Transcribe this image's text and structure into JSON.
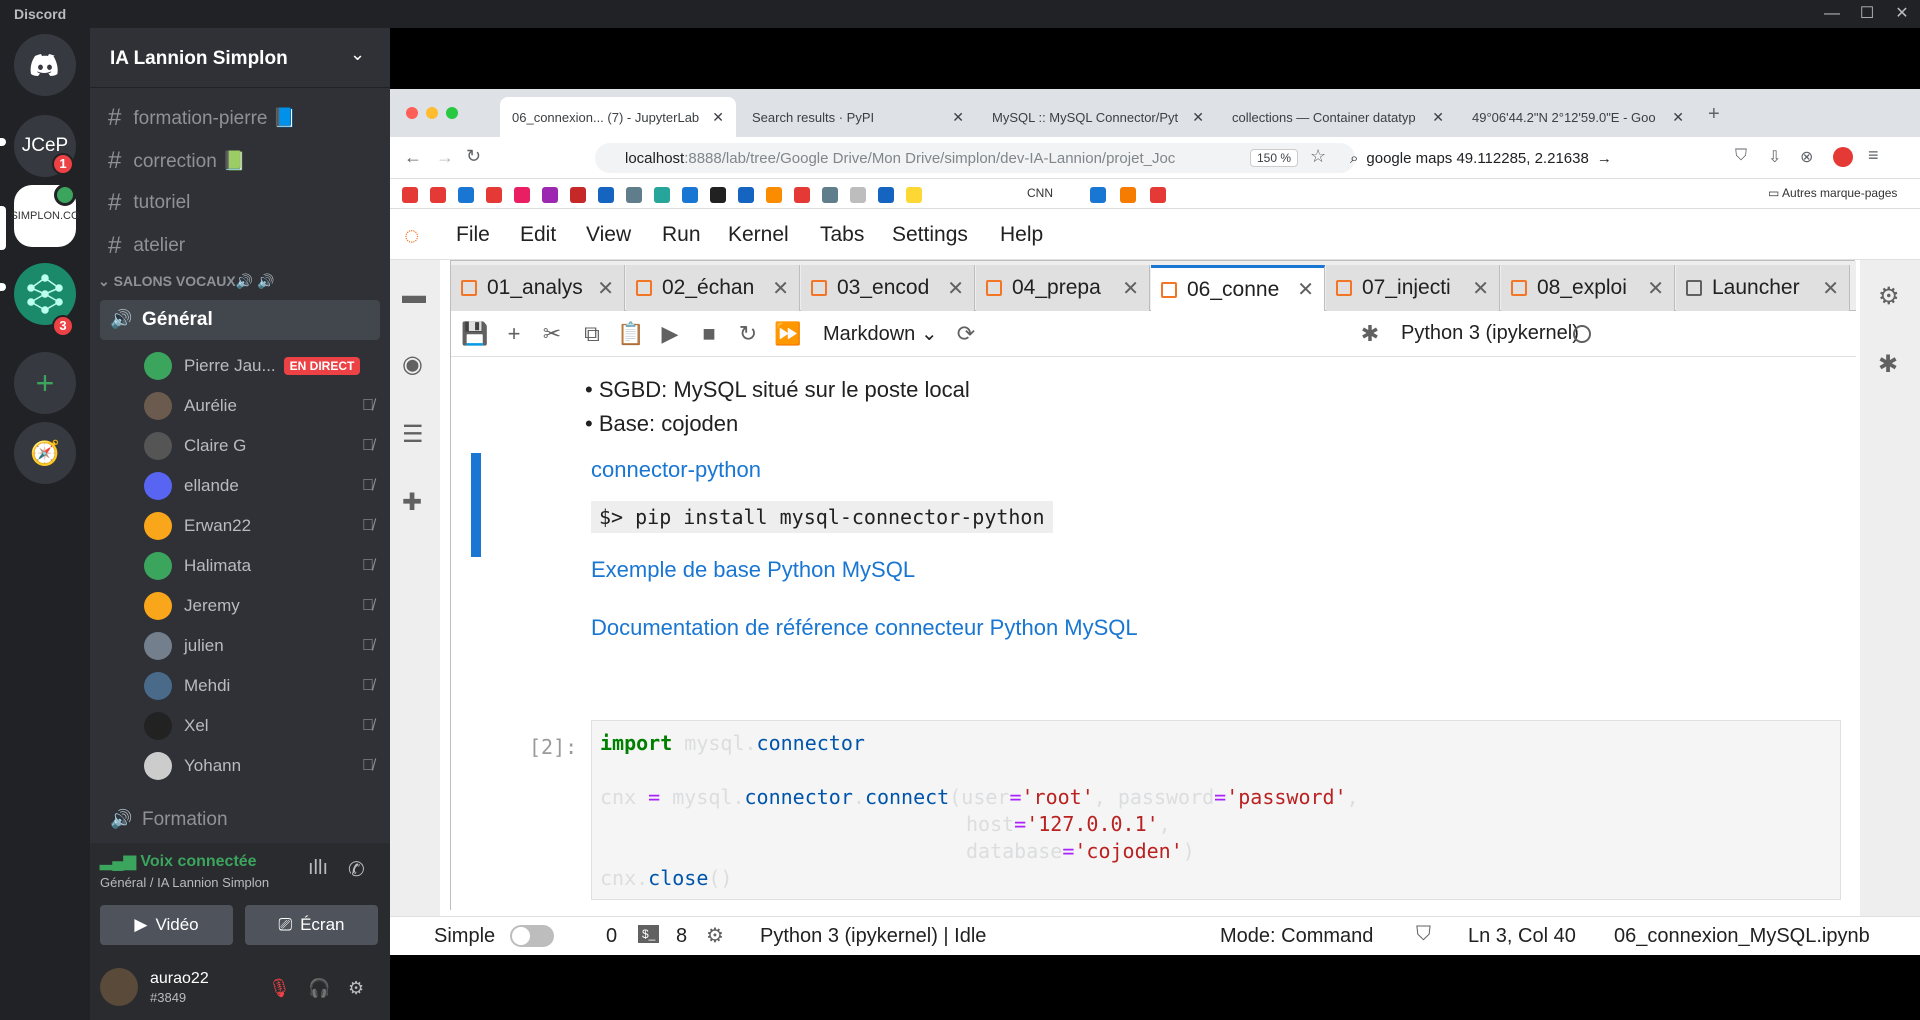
{
  "window": {
    "app_title": "Discord"
  },
  "servers": [
    {
      "name": "JCeP",
      "badge": "1"
    },
    {
      "name": "SIMPLON.CO"
    },
    {
      "name": "network-server",
      "badge": "3"
    }
  ],
  "guild": {
    "name": "IA Lannion Simplon"
  },
  "text_channels": [
    {
      "label": "formation-pierre 📘"
    },
    {
      "label": "correction 📗"
    },
    {
      "label": "tutoriel"
    },
    {
      "label": "atelier"
    }
  ],
  "voice_category": {
    "label": "SALONS VOCAUX🔊 🔊"
  },
  "voice_channels": [
    {
      "label": "Général"
    },
    {
      "label": "Formation"
    }
  ],
  "voice_members": [
    {
      "name": "Pierre Jau...",
      "live": "EN DIRECT",
      "color": "#3ba55d"
    },
    {
      "name": "Aurélie",
      "color": "#6b5a4e"
    },
    {
      "name": "Claire G",
      "color": "#555555"
    },
    {
      "name": "ellande",
      "color": "#5865f2"
    },
    {
      "name": "Erwan22",
      "color": "#faa61a"
    },
    {
      "name": "Halimata",
      "color": "#3ba55d"
    },
    {
      "name": "Jeremy",
      "color": "#faa61a"
    },
    {
      "name": "julien",
      "color": "#747f8d"
    },
    {
      "name": "Mehdi",
      "color": "#4a6a8a"
    },
    {
      "name": "Xel",
      "color": "#222222"
    },
    {
      "name": "Yohann",
      "color": "#cccccc"
    }
  ],
  "voice_panel": {
    "status": "Voix connectée",
    "location": "Général / IA Lannion Simplon",
    "video_label": "Vidéo",
    "screen_label": "Écran"
  },
  "user": {
    "name": "aurao22",
    "tag": "#3849"
  },
  "browser": {
    "tabs": [
      {
        "label": "06_connexion... (7) - JupyterLab"
      },
      {
        "label": "Search results · PyPI"
      },
      {
        "label": "MySQL :: MySQL Connector/Pyt"
      },
      {
        "label": "collections — Container datatyp"
      },
      {
        "label": "49°06'44.2\"N 2°12'59.0\"E - Goo"
      }
    ],
    "url_host": "localhost",
    "url_rest": ":8888/lab/tree/Google Drive/Mon Drive/simplon/dev-IA-Lannion/projet_Joc",
    "zoom": "150 %",
    "search": "google maps 49.112285, 2.21638",
    "bookmark_text": "CNN",
    "other_bookmarks": "Autres marque-pages"
  },
  "jupyter": {
    "menu": [
      "File",
      "Edit",
      "View",
      "Run",
      "Kernel",
      "Tabs",
      "Settings",
      "Help"
    ],
    "tabs": [
      {
        "label": "01_analys"
      },
      {
        "label": "02_échan"
      },
      {
        "label": "03_encod"
      },
      {
        "label": "04_prepa"
      },
      {
        "label": "06_conne"
      },
      {
        "label": "07_injecti"
      },
      {
        "label": "08_exploi"
      },
      {
        "label": "Launcher"
      }
    ],
    "cell_type": "Markdown",
    "kernel": "Python 3 (ipykernel)",
    "bullets": [
      "SGBD: MySQL situé sur le poste local",
      "Base: cojoden"
    ],
    "heading_link": "connector-python",
    "pip_cmd": "$> pip install mysql-connector-python",
    "link1": "Exemple de base Python MySQL",
    "link2": "Documentation de référence connecteur Python MySQL",
    "prompt": "[2]:",
    "code": {
      "l1_kw": "import",
      "l1_a": " mysql.",
      "l1_fn": "connector",
      "l3_a": "cnx ",
      "l3_eq": "=",
      "l3_b": " mysql.",
      "l3_fn1": "connector",
      "l3_dot": ".",
      "l3_fn2": "connect",
      "l3_c": "(user",
      "l3_eq2": "=",
      "l3_s1": "'root'",
      "l3_d": ", password",
      "l3_eq3": "=",
      "l3_s2": "'password'",
      "l3_e": ",",
      "l4_a": "host",
      "l4_eq": "=",
      "l4_s": "'127.0.0.1'",
      "l4_b": ",",
      "l5_a": "database",
      "l5_eq": "=",
      "l5_s": "'cojoden'",
      "l5_b": ")",
      "l6_a": "cnx.",
      "l6_fn": "close",
      "l6_b": "()"
    },
    "status": {
      "mode_label": "Simple",
      "n1": "0",
      "n2": "8",
      "kernel_state": "Python 3 (ipykernel) | Idle",
      "mode": "Mode: Command",
      "cursor": "Ln 3, Col 40",
      "file": "06_connexion_MySQL.ipynb"
    }
  }
}
